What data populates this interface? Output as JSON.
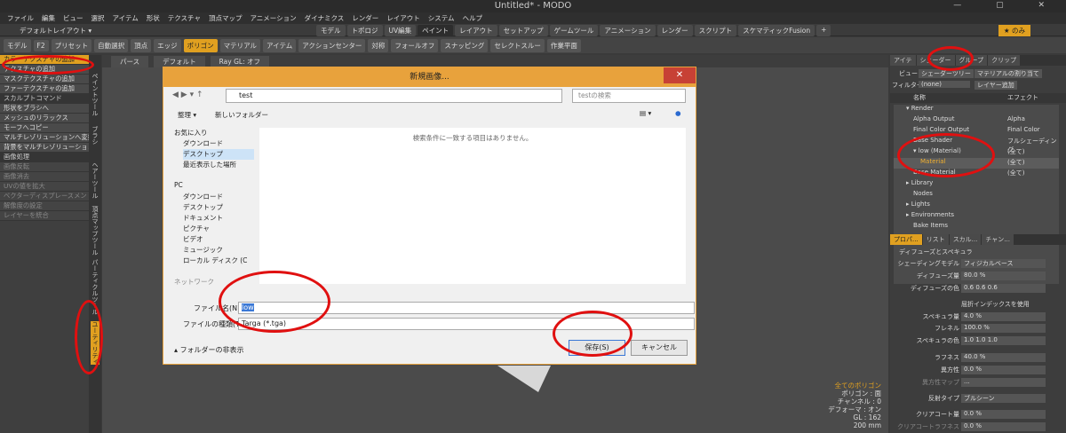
{
  "window": {
    "title": "Untitled* - MODO"
  },
  "menu": [
    "ファイル",
    "編集",
    "ビュー",
    "選択",
    "アイテム",
    "形状",
    "テクスチャ",
    "頂点マップ",
    "アニメーション",
    "ダイナミクス",
    "レンダー",
    "レイアウト",
    "システム",
    "ヘルプ"
  ],
  "layout_label": "デフォルトレイアウト ▾",
  "tabs": [
    "モデル",
    "トポロジ",
    "UV編集",
    "ペイント",
    "レイアウト",
    "セットアップ",
    "ゲームツール",
    "アニメーション",
    "レンダー",
    "スクリプト",
    "スケマティックFusion",
    "+"
  ],
  "tab_right": "★ のみ",
  "toolbar": [
    "モデル",
    "F2",
    "プリセット",
    "自動選択",
    "頂点",
    "エッジ",
    "ポリゴン",
    "マテリアル",
    "アイテム",
    "アクションセンター",
    "対称",
    "フォールオフ",
    "スナッピング",
    "セレクトスルー",
    "作業平面"
  ],
  "left_panel": {
    "items": [
      {
        "label": "カラーテクスチャの追加",
        "style": "hl"
      },
      {
        "label": "テクスチャの追加",
        "style": ""
      },
      {
        "label": "マスクテクスチャの追加",
        "style": ""
      },
      {
        "label": "ファーテクスチャの追加",
        "style": ""
      },
      {
        "label": "スカルプトコマンド",
        "style": "head"
      },
      {
        "label": "形状をブラシへ",
        "style": ""
      },
      {
        "label": "メッシュのリラックス",
        "style": ""
      },
      {
        "label": "モーフへコピー",
        "style": ""
      },
      {
        "label": "マルチレゾリューションへ変換",
        "style": ""
      },
      {
        "label": "背景をマルチレゾリューションへ",
        "style": ""
      },
      {
        "label": "画像処理",
        "style": "head"
      },
      {
        "label": "画像反転",
        "style": "dim"
      },
      {
        "label": "画像消去",
        "style": "dim"
      },
      {
        "label": "UVの値を拡大",
        "style": "dim"
      },
      {
        "label": "ベクターディスプレースメント",
        "style": "dim"
      },
      {
        "label": "解像度の設定",
        "style": "dim"
      },
      {
        "label": "レイヤーを統合",
        "style": "dim"
      }
    ],
    "vertical_tabs": [
      "ペイントツール",
      "ブラシ",
      "ヘアーツール",
      "頂点マップツール",
      "パーティクルツール",
      "ユーティリティ"
    ]
  },
  "viewport": {
    "top": [
      "パース",
      "デフォルト",
      "Ray GL: オフ"
    ],
    "info": {
      "title": "全てのポリゴン",
      "l1": "ポリゴン : 面",
      "l2": "チャンネル : 0",
      "l3": "デフォーマ : オン",
      "l4": "GL : 162",
      "l5": "200 mm"
    }
  },
  "dialog": {
    "title": "新規画像...",
    "path": "test",
    "search_placeholder": "testの検索",
    "organize": "整理 ▾",
    "new_folder": "新しいフォルダー",
    "empty_msg": "検索条件に一致する項目はありません。",
    "nav": [
      "お気に入り",
      "ダウンロード",
      "デスクトップ",
      "最近表示した場所",
      "",
      "PC",
      "ダウンロード",
      "デスクトップ",
      "ドキュメント",
      "ピクチャ",
      "ビデオ",
      "ミュージック",
      "ローカル ディスク (C",
      "",
      "ネットワーク"
    ],
    "filename_label": "ファイル名(N):",
    "filename_value": "low",
    "filetype_label": "ファイルの種類(T):",
    "filetype_value": "Targa (*.tga)",
    "hide_folders": "フォルダーの非表示",
    "save": "保存(S)",
    "cancel": "キャンセル"
  },
  "right_panel": {
    "tabs": [
      "アイテ",
      "シェーダー",
      "グループ",
      "クリップ"
    ],
    "view_label": "ビュー",
    "view_value": "シェーダーツリー",
    "assign": "マテリアルの割り当て",
    "filter_label": "フィルター",
    "filter_value": "(none)",
    "add_layer": "レイヤー追加",
    "col_name": "名称",
    "col_effect": "エフェクト",
    "tree": [
      {
        "name": "▾ Render",
        "effect": ""
      },
      {
        "name": "  Alpha Output",
        "effect": "Alpha"
      },
      {
        "name": "  Final Color Output",
        "effect": "Final Color"
      },
      {
        "name": "  Base Shader",
        "effect": "フルシェーディング"
      },
      {
        "name": "▾ low (Material)",
        "effect": "(全て)"
      },
      {
        "name": "    Material",
        "effect": "(全て)"
      },
      {
        "name": "  Base Material",
        "effect": "(全て)"
      },
      {
        "name": "▸ Library",
        "effect": ""
      },
      {
        "name": "  Nodes",
        "effect": ""
      },
      {
        "name": "▸ Lights",
        "effect": ""
      },
      {
        "name": "▸ Environments",
        "effect": ""
      },
      {
        "name": "  Bake Items",
        "effect": ""
      }
    ],
    "prop_tabs": [
      "プロパ...",
      "リスト",
      "スカル...",
      "チャン..."
    ],
    "section": "ディフューズとスペキュラ",
    "props": [
      {
        "label": "シェーディングモデル",
        "value": "フィジカルベース"
      },
      {
        "label": "ディフューズ量",
        "value": "80.0 %"
      },
      {
        "label": "ディフューズの色",
        "value": "0.6   0.6   0.6"
      },
      {
        "label": "屈折インデックスを使用",
        "value": ""
      },
      {
        "label": "スペキュラ量",
        "value": "4.0 %"
      },
      {
        "label": "フレネル",
        "value": "100.0 %"
      },
      {
        "label": "スペキュラの色",
        "value": "1.0   1.0   1.0"
      },
      {
        "label": "ラフネス",
        "value": "40.0 %"
      },
      {
        "label": "異方性",
        "value": "0.0 %"
      },
      {
        "label": "異方性マップ",
        "value": "..."
      },
      {
        "label": "反射タイプ",
        "value": "ブルシーン"
      },
      {
        "label": "クリアコート量",
        "value": "0.0 %"
      },
      {
        "label": "クリアコートラフネス",
        "value": "0.0 %"
      }
    ]
  },
  "colors": {
    "accent": "#e0a020",
    "dialog_accent": "#e8a23c",
    "close": "#c74135",
    "annotation": "#e01010"
  }
}
